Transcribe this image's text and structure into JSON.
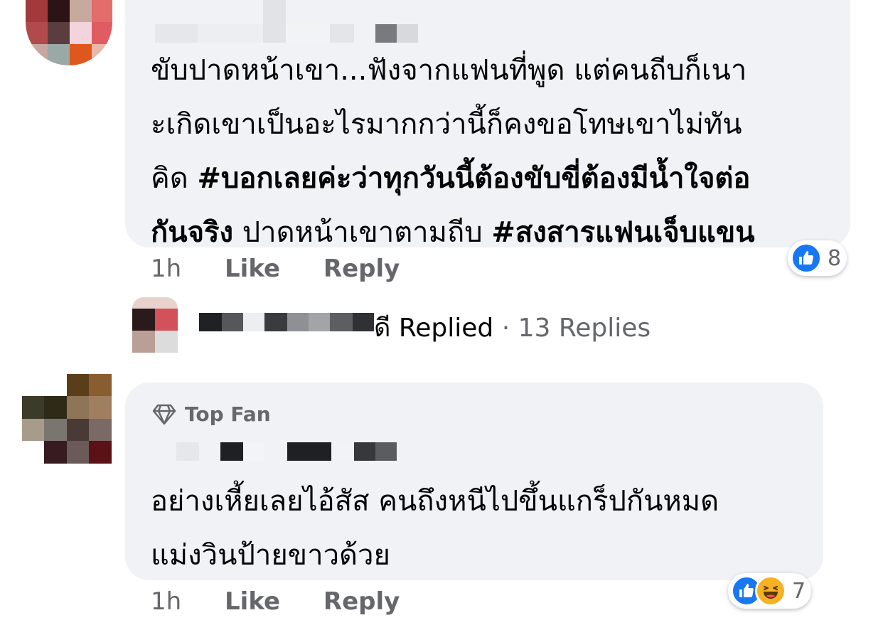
{
  "comment1": {
    "lines": [
      {
        "parts": [
          {
            "text": "ขับปาดหน้าเขา...ฟังจากแฟนที่พูด แต่คนถีบก็เนา",
            "bold": false
          }
        ]
      },
      {
        "parts": [
          {
            "text": "ะเกิดเขาเป็นอะไรมากกว่านี้ก็คงขอโทษเขาไม่ทัน",
            "bold": false
          }
        ]
      },
      {
        "parts": [
          {
            "text": "คิด ",
            "bold": false
          },
          {
            "text": "#บอกเลยค่ะว่าทุกวันนี้ต้องขับขี่ต้องมีน้ำใจต่อ",
            "bold": true
          }
        ]
      },
      {
        "parts": [
          {
            "text": "กันจริง",
            "bold": true
          },
          {
            "text": " ปาดหน้าเขาตามถีบ ",
            "bold": false
          },
          {
            "text": "#สงสารแฟนเจ็บแขน",
            "bold": true
          }
        ]
      }
    ],
    "time": "1h",
    "like_label": "Like",
    "reply_label": "Reply",
    "reaction_count": "8",
    "reaction_icons": [
      "like-icon"
    ]
  },
  "replies_row": {
    "name_tail": "ดี",
    "replied_label": "Replied",
    "separator": "·",
    "replies_count": "13 Replies"
  },
  "comment2": {
    "badge_label": "Top Fan",
    "badge_icon": "diamond-icon",
    "lines": [
      {
        "parts": [
          {
            "text": "อย่างเหี้ยเลยไอ้สัส คนถึงหนีไปขึ้นแกร็ปกันหมด",
            "bold": false
          }
        ]
      },
      {
        "parts": [
          {
            "text": "แม่งวินป้ายขาวด้วย",
            "bold": false
          }
        ]
      }
    ],
    "time": "1h",
    "like_label": "Like",
    "reply_label": "Reply",
    "reaction_count": "7",
    "reaction_icons": [
      "like-icon",
      "haha-icon"
    ]
  },
  "colors": {
    "bubble": "#f0f2f5",
    "link": "#65676b",
    "like_blue": "#1877f2",
    "haha_yellow": "#f7b125"
  }
}
